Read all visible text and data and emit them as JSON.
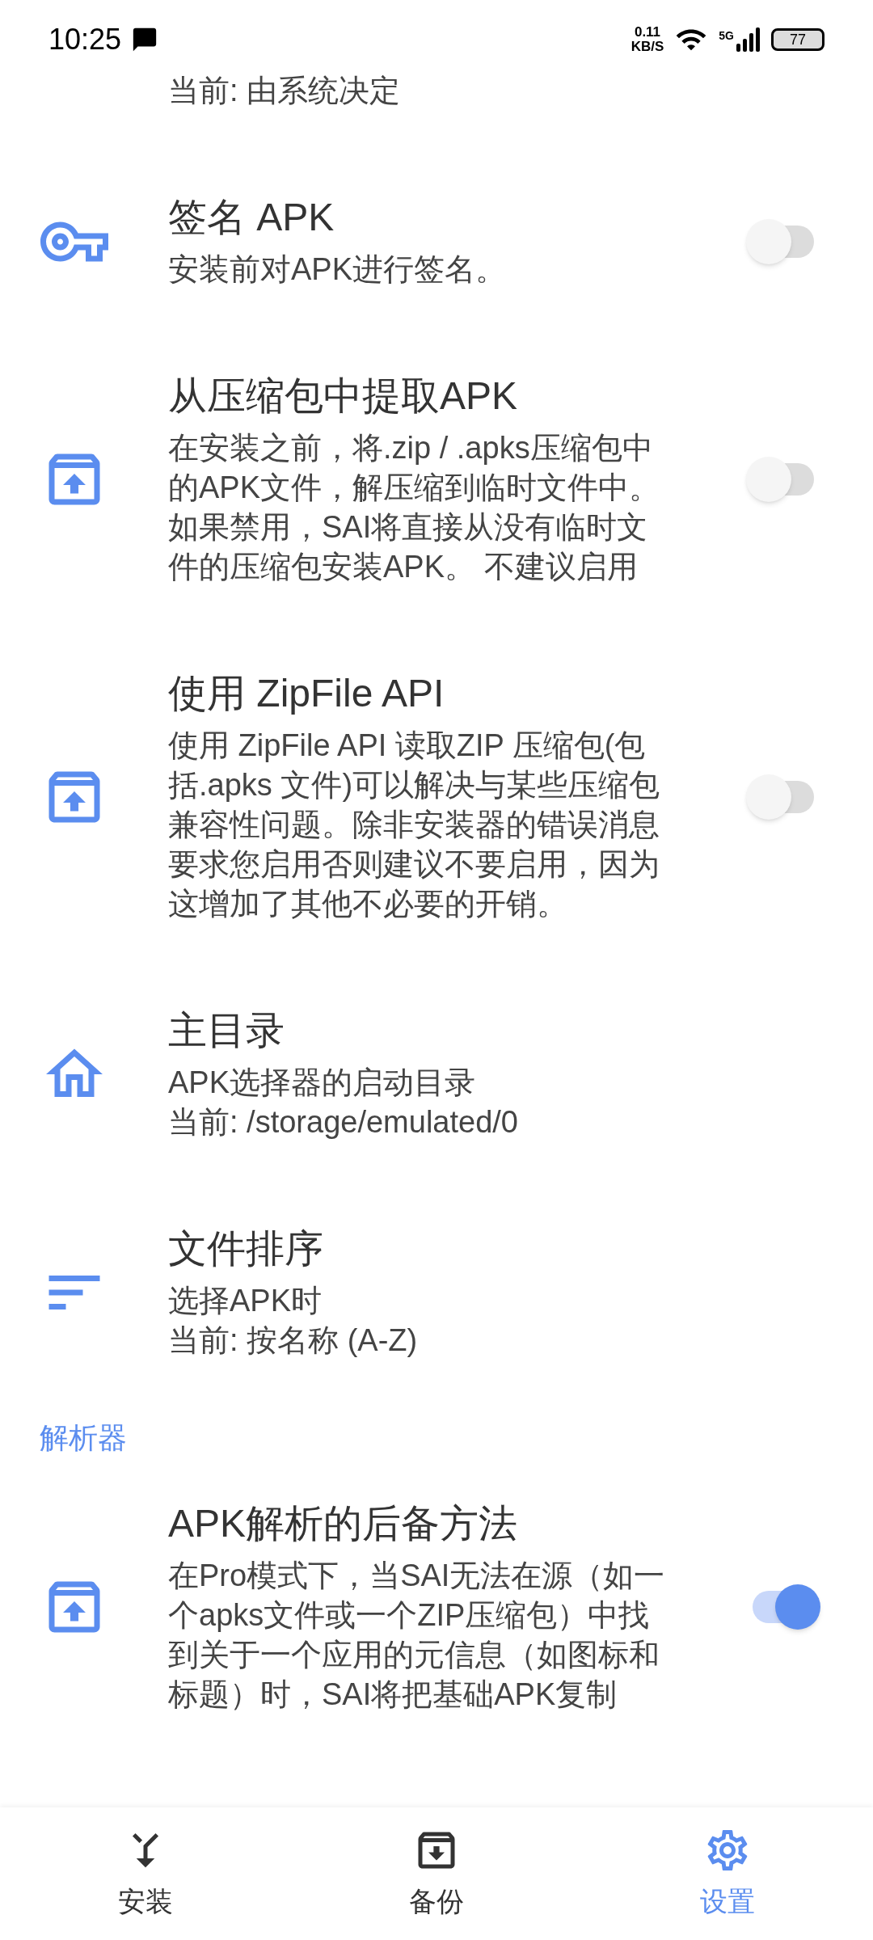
{
  "status_bar": {
    "time": "10:25",
    "net_speed": [
      "0.11",
      "KB/S"
    ],
    "network": "5G",
    "battery": "77"
  },
  "top_fragment": "当前: 由系统决定",
  "groups": [
    {
      "items": [
        {
          "kind": "switch",
          "title": "签名 APK",
          "lines": [
            "安装前对APK进行签名。"
          ],
          "on": false
        },
        {
          "kind": "switch",
          "title": "从压缩包中提取APK",
          "lines": [
            "在安装之前，将.zip / .apks压缩包中的APK文件，解压缩到临时文件中。如果禁用，SAI将直接从没有临时文件的压缩包安装APK。 不建议启用"
          ],
          "on": false
        },
        {
          "kind": "switch",
          "title": "使用 ZipFile API",
          "lines": [
            "使用 ZipFile API 读取ZIP 压缩包(包括.apks 文件)可以解决与某些压缩包兼容性问题。除非安装器的错误消息要求您启用否则建议不要启用，因为这增加了其他不必要的开销。"
          ],
          "on": false
        },
        {
          "kind": "info",
          "title": "主目录",
          "lines": [
            "APK选择器的启动目录",
            "当前: /storage/emulated/0"
          ]
        },
        {
          "kind": "info",
          "title": "文件排序",
          "lines": [
            "选择APK时",
            "当前: 按名称 (A-Z)"
          ]
        }
      ]
    },
    {
      "header": "解析器",
      "items": [
        {
          "kind": "switch",
          "title": "APK解析的后备方法",
          "lines": [
            "在Pro模式下，当SAI无法在源（如一个apks文件或一个ZIP压缩包）中找到关于一个应用的元信息（如图标和标题）时，SAI将把基础APK复制"
          ],
          "on": true
        }
      ]
    }
  ],
  "nav": [
    {
      "label": "安装",
      "selected": false
    },
    {
      "label": "备份",
      "selected": false
    },
    {
      "label": "设置",
      "selected": true
    }
  ]
}
